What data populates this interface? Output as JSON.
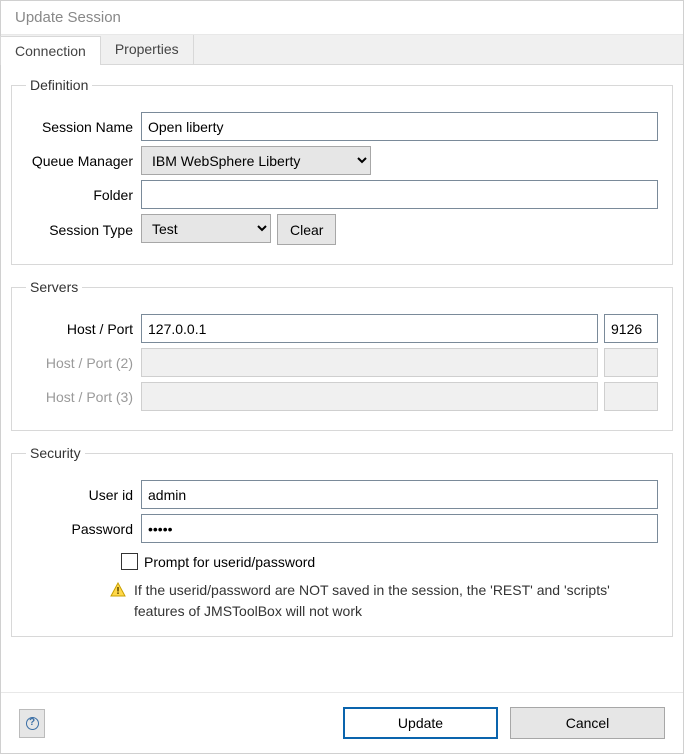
{
  "title": "Update Session",
  "tabs": {
    "connection": "Connection",
    "properties": "Properties"
  },
  "definition": {
    "legend": "Definition",
    "session_name_label": "Session Name",
    "session_name": "Open liberty",
    "queue_manager_label": "Queue Manager",
    "queue_manager": "IBM WebSphere Liberty",
    "folder_label": "Folder",
    "folder": "",
    "session_type_label": "Session Type",
    "session_type": "Test",
    "clear_label": "Clear"
  },
  "servers": {
    "legend": "Servers",
    "rows": [
      {
        "label": "Host / Port",
        "host": "127.0.0.1",
        "port": "9126",
        "enabled": true
      },
      {
        "label": "Host / Port (2)",
        "host": "",
        "port": "",
        "enabled": false
      },
      {
        "label": "Host / Port (3)",
        "host": "",
        "port": "",
        "enabled": false
      }
    ]
  },
  "security": {
    "legend": "Security",
    "user_label": "User id",
    "user": "admin",
    "password_label": "Password",
    "password": "•••••",
    "prompt_label": "Prompt for userid/password",
    "warn_text": "If the userid/password are NOT saved in the session, the 'REST' and 'scripts' features of JMSToolBox will not work"
  },
  "buttons": {
    "update": "Update",
    "cancel": "Cancel"
  }
}
